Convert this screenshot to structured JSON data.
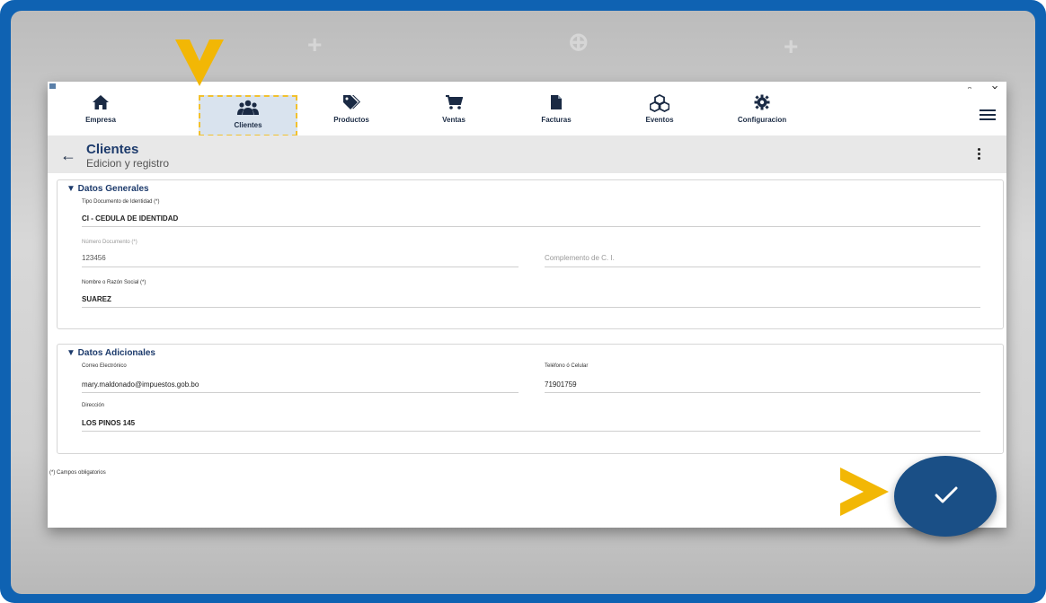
{
  "nav": {
    "items": [
      {
        "label": "Empresa",
        "icon": "home-icon"
      },
      {
        "label": "Clientes",
        "icon": "users-icon",
        "active": true
      },
      {
        "label": "Productos",
        "icon": "tags-icon"
      },
      {
        "label": "Ventas",
        "icon": "cart-icon"
      },
      {
        "label": "Facturas",
        "icon": "file-icon"
      },
      {
        "label": "Eventos",
        "icon": "cubes-icon"
      },
      {
        "label": "Configuracion",
        "icon": "gear-icon"
      }
    ]
  },
  "window_controls": {
    "minimize": "–",
    "restore": "▫",
    "close": "×"
  },
  "header": {
    "title": "Clientes",
    "subtitle": "Edicion y registro"
  },
  "general": {
    "title": "▼ Datos Generales",
    "tipo_label": "Tipo Documento de Identidad (*)",
    "tipo_value": "CI - CEDULA DE IDENTIDAD",
    "numero_label": "Número Documento (*)",
    "numero_value": "123456",
    "complemento_placeholder": "Complemento de C. I.",
    "nombre_label": "Nombre o Razón Social (*)",
    "nombre_value": "SUAREZ"
  },
  "adicionales": {
    "title": "▼ Datos Adicionales",
    "correo_label": "Correo Electrónico",
    "correo_value": "mary.maldonado@impuestos.gob.bo",
    "telefono_label": "Teléfono ó Celular",
    "telefono_value": "71901759",
    "direccion_label": "Dirección",
    "direccion_value": "LOS PINOS 145"
  },
  "footnote": "(*) Campos obligatorios",
  "colors": {
    "frame": "#0f62b2",
    "accent": "#1d3b6c",
    "fab": "#1a4f86",
    "pointer": "#f2b705"
  }
}
